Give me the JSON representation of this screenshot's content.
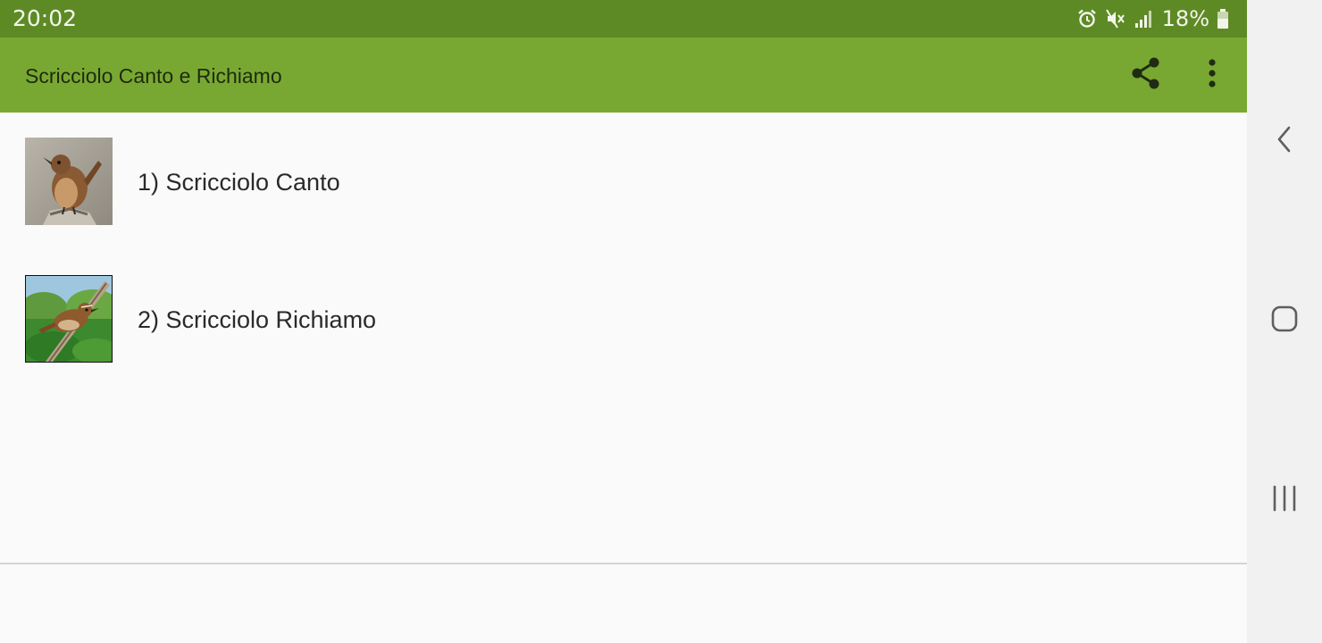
{
  "status_bar": {
    "time": "20:02",
    "battery_percent": "18%",
    "icons": [
      "alarm-icon",
      "mute-icon",
      "signal-icon",
      "battery-icon"
    ]
  },
  "app_bar": {
    "title": "Scricciolo Canto e Richiamo",
    "actions": [
      "share-icon",
      "more-vert-icon"
    ]
  },
  "list": {
    "items": [
      {
        "label": "1) Scricciolo Canto",
        "thumbnail": "wren-perched-photo"
      },
      {
        "label": "2) Scricciolo Richiamo",
        "thumbnail": "wren-on-branch-painting"
      }
    ]
  },
  "nav_bar": {
    "buttons": [
      "back-icon",
      "home-icon",
      "recent-apps-icon"
    ]
  },
  "colors": {
    "status_bar": "#5e8a25",
    "app_bar": "#79a832",
    "background": "#fafafa",
    "nav_bar": "#f1f1f1"
  }
}
